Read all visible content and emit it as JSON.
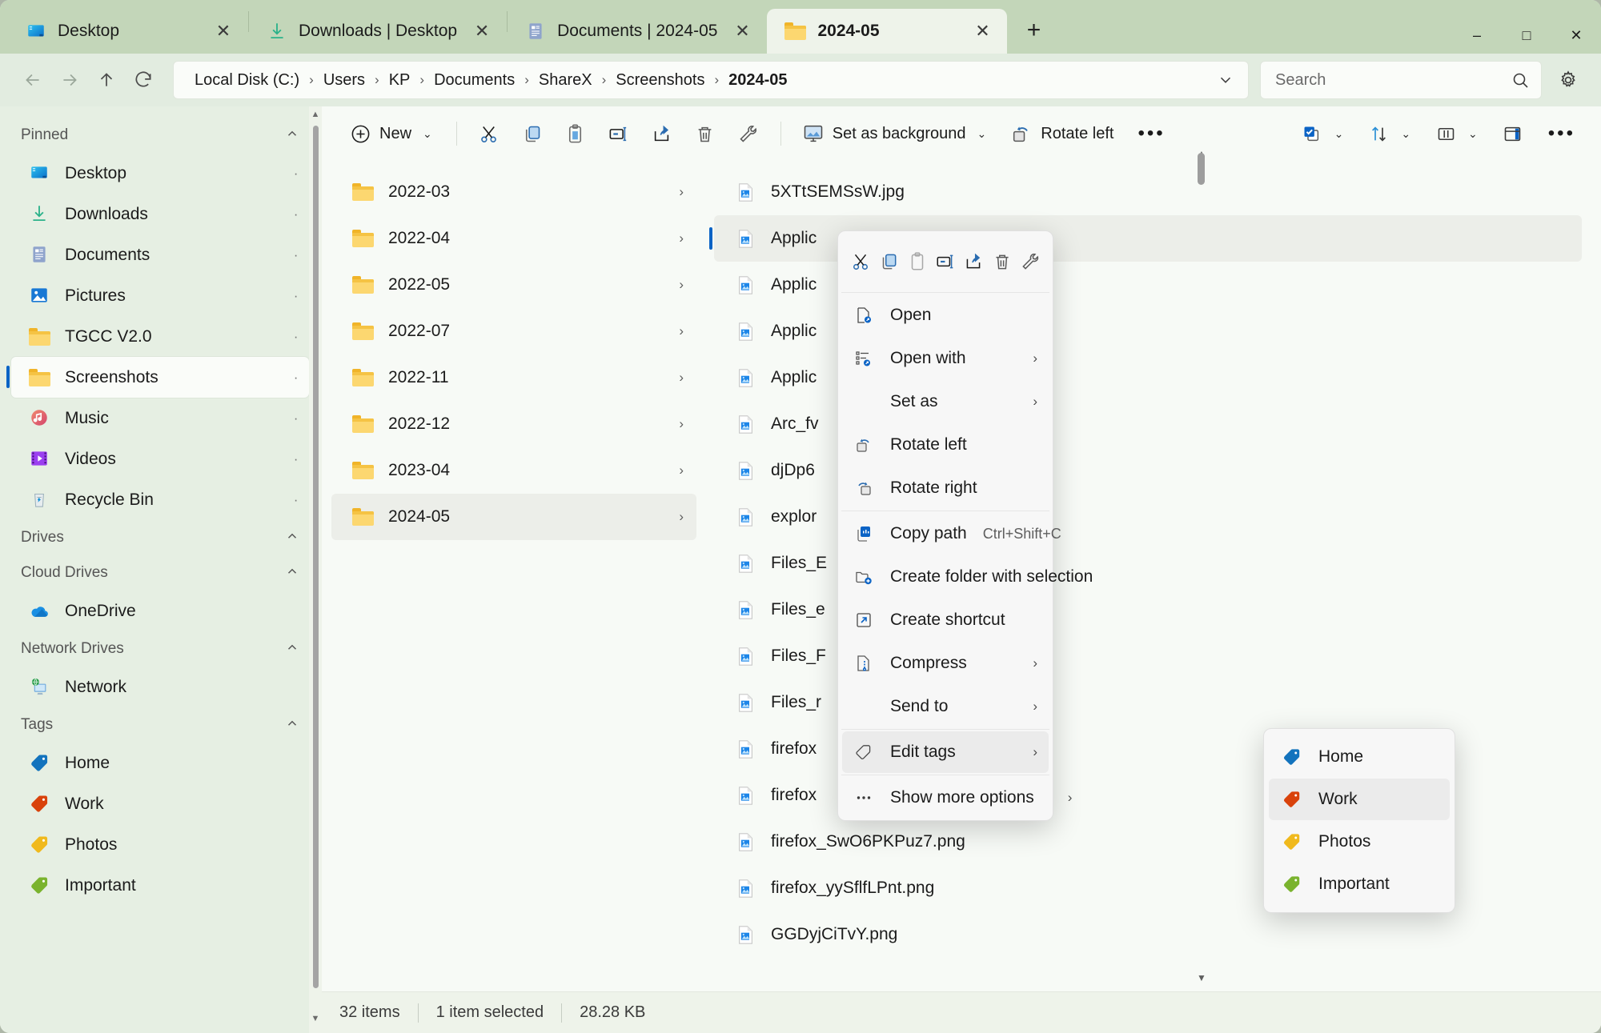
{
  "window": {
    "accent": "#0b63c5",
    "titlebar_color": "#c3d6b9",
    "controls": {
      "minimize": "–",
      "maximize": "□",
      "close": "✕"
    }
  },
  "tabs": [
    {
      "label": "Desktop",
      "icon": "desktop-icon",
      "active": false,
      "close": "✕"
    },
    {
      "label": "Downloads | Desktop",
      "icon": "downloads-icon",
      "active": false,
      "close": "✕"
    },
    {
      "label": "Documents | 2024-05",
      "icon": "documents-icon",
      "active": false,
      "close": "✕"
    },
    {
      "label": "2024-05",
      "icon": "folder-icon",
      "active": true,
      "close": "✕"
    }
  ],
  "new_tab_label": "+",
  "nav": {
    "back": "back-arrow-icon",
    "forward": "forward-arrow-icon",
    "up": "up-arrow-icon",
    "refresh": "refresh-icon"
  },
  "breadcrumb": {
    "separator": "›",
    "items": [
      "Local Disk (C:)",
      "Users",
      "KP",
      "Documents",
      "ShareX",
      "Screenshots",
      "2024-05"
    ]
  },
  "search": {
    "placeholder": "Search",
    "icon": "search-icon"
  },
  "settings_icon": "gear-icon",
  "sidebar": {
    "groups": [
      {
        "title": "Pinned",
        "chevron": "⌃",
        "items": [
          {
            "label": "Desktop",
            "icon": "desktop-icon",
            "pin": "·",
            "selected": false
          },
          {
            "label": "Downloads",
            "icon": "downloads-icon",
            "pin": "·",
            "selected": false
          },
          {
            "label": "Documents",
            "icon": "documents-icon",
            "pin": "·",
            "selected": false
          },
          {
            "label": "Pictures",
            "icon": "pictures-icon",
            "pin": "·",
            "selected": false
          },
          {
            "label": "TGCC V2.0",
            "icon": "folder-icon",
            "pin": "·",
            "selected": false
          },
          {
            "label": "Screenshots",
            "icon": "folder-icon",
            "pin": "·",
            "selected": true
          },
          {
            "label": "Music",
            "icon": "music-icon",
            "pin": "·",
            "selected": false
          },
          {
            "label": "Videos",
            "icon": "videos-icon",
            "pin": "·",
            "selected": false
          },
          {
            "label": "Recycle Bin",
            "icon": "recycle-bin-icon",
            "pin": "·",
            "selected": false
          }
        ]
      },
      {
        "title": "Drives",
        "chevron": "⌃",
        "items": []
      },
      {
        "title": "Cloud Drives",
        "chevron": "⌃",
        "items": [
          {
            "label": "OneDrive",
            "icon": "onedrive-icon",
            "pin": "",
            "selected": false
          }
        ]
      },
      {
        "title": "Network Drives",
        "chevron": "⌃",
        "items": [
          {
            "label": "Network",
            "icon": "network-icon",
            "pin": "",
            "selected": false
          }
        ]
      },
      {
        "title": "Tags",
        "chevron": "⌃",
        "items": [
          {
            "label": "Home",
            "icon": "tag-icon",
            "color": "#1373bd",
            "pin": "",
            "selected": false
          },
          {
            "label": "Work",
            "icon": "tag-icon",
            "color": "#d9420b",
            "pin": "",
            "selected": false
          },
          {
            "label": "Photos",
            "icon": "tag-icon",
            "color": "#f0b91d",
            "pin": "",
            "selected": false
          },
          {
            "label": "Important",
            "icon": "tag-icon",
            "color": "#7ab32e",
            "pin": "",
            "selected": false
          }
        ]
      }
    ]
  },
  "toolbar": {
    "new_label": "New",
    "new_chevron": "⌄",
    "cut": "cut-icon",
    "copy": "copy-icon",
    "paste": "paste-icon",
    "rename": "rename-icon",
    "share": "share-icon",
    "delete": "delete-icon",
    "properties": "properties-icon",
    "set_as_background_label": "Set as background",
    "set_as_background_chevron": "⌄",
    "rotate_left_label": "Rotate left",
    "overflow_label": "•••",
    "select_chevron": "⌄",
    "sort_chevron": "⌄",
    "layout_chevron": "⌄",
    "details_pane": "details-pane-icon",
    "more": "•••"
  },
  "tree": {
    "chevron": "›",
    "folders": [
      {
        "name": "2022-03",
        "selected": false
      },
      {
        "name": "2022-04",
        "selected": false
      },
      {
        "name": "2022-05",
        "selected": false
      },
      {
        "name": "2022-07",
        "selected": false
      },
      {
        "name": "2022-11",
        "selected": false
      },
      {
        "name": "2022-12",
        "selected": false
      },
      {
        "name": "2023-04",
        "selected": false
      },
      {
        "name": "2024-05",
        "selected": true
      }
    ]
  },
  "files": [
    {
      "name": "5XTtSEMSsW.jpg",
      "selected": false
    },
    {
      "name": "Applic",
      "selected": true
    },
    {
      "name": "Applic",
      "selected": false
    },
    {
      "name": "Applic",
      "selected": false
    },
    {
      "name": "Applic",
      "selected": false
    },
    {
      "name": "Arc_fv",
      "selected": false
    },
    {
      "name": "djDp6",
      "selected": false
    },
    {
      "name": "explor",
      "selected": false
    },
    {
      "name": "Files_E",
      "selected": false
    },
    {
      "name": "Files_e",
      "selected": false
    },
    {
      "name": "Files_F",
      "selected": false
    },
    {
      "name": "Files_r",
      "selected": false
    },
    {
      "name": "firefox",
      "selected": false
    },
    {
      "name": "firefox",
      "selected": false
    },
    {
      "name": "firefox_SwO6PKPuz7.png",
      "selected": false
    },
    {
      "name": "firefox_yySflfLPnt.png",
      "selected": false
    },
    {
      "name": "GGDyjCiTvY.png",
      "selected": false
    }
  ],
  "context_menu": {
    "icon_row": [
      {
        "name": "cut-icon"
      },
      {
        "name": "copy-icon"
      },
      {
        "name": "paste-icon"
      },
      {
        "name": "rename-icon"
      },
      {
        "name": "share-icon"
      },
      {
        "name": "delete-icon"
      },
      {
        "name": "properties-icon"
      }
    ],
    "items": [
      {
        "label": "Open",
        "icon": "open-icon",
        "accel": "",
        "submenu": "",
        "highlight": false
      },
      {
        "label": "Open with",
        "icon": "open-with-icon",
        "accel": "",
        "submenu": "›",
        "highlight": false
      },
      {
        "label": "Set as",
        "icon": "",
        "accel": "",
        "submenu": "›",
        "highlight": false
      },
      {
        "label": "Rotate left",
        "icon": "rotate-left-icon",
        "accel": "",
        "submenu": "",
        "highlight": false
      },
      {
        "label": "Rotate right",
        "icon": "rotate-right-icon",
        "accel": "",
        "submenu": "",
        "highlight": false
      },
      {
        "label": "Copy path",
        "icon": "copy-path-icon",
        "accel": "Ctrl+Shift+C",
        "submenu": "",
        "highlight": false
      },
      {
        "label": "Create folder with selection",
        "icon": "create-folder-icon",
        "accel": "",
        "submenu": "",
        "highlight": false
      },
      {
        "label": "Create shortcut",
        "icon": "create-shortcut-icon",
        "accel": "",
        "submenu": "",
        "highlight": false
      },
      {
        "label": "Compress",
        "icon": "compress-icon",
        "accel": "",
        "submenu": "›",
        "highlight": false
      },
      {
        "label": "Send to",
        "icon": "",
        "accel": "",
        "submenu": "›",
        "highlight": false
      },
      {
        "label": "Edit tags",
        "icon": "tag-outline-icon",
        "accel": "",
        "submenu": "›",
        "highlight": true
      },
      {
        "label": "Show more options",
        "icon": "more-options-icon",
        "accel": "",
        "submenu": "›",
        "highlight": false
      }
    ]
  },
  "tag_submenu": {
    "items": [
      {
        "label": "Home",
        "color": "#1373bd",
        "highlight": false
      },
      {
        "label": "Work",
        "color": "#d9420b",
        "highlight": true
      },
      {
        "label": "Photos",
        "color": "#f0b91d",
        "highlight": false
      },
      {
        "label": "Important",
        "color": "#7ab32e",
        "highlight": false
      }
    ]
  },
  "status": {
    "item_count": "32 items",
    "selection": "1 item selected",
    "size": "28.28 KB"
  }
}
